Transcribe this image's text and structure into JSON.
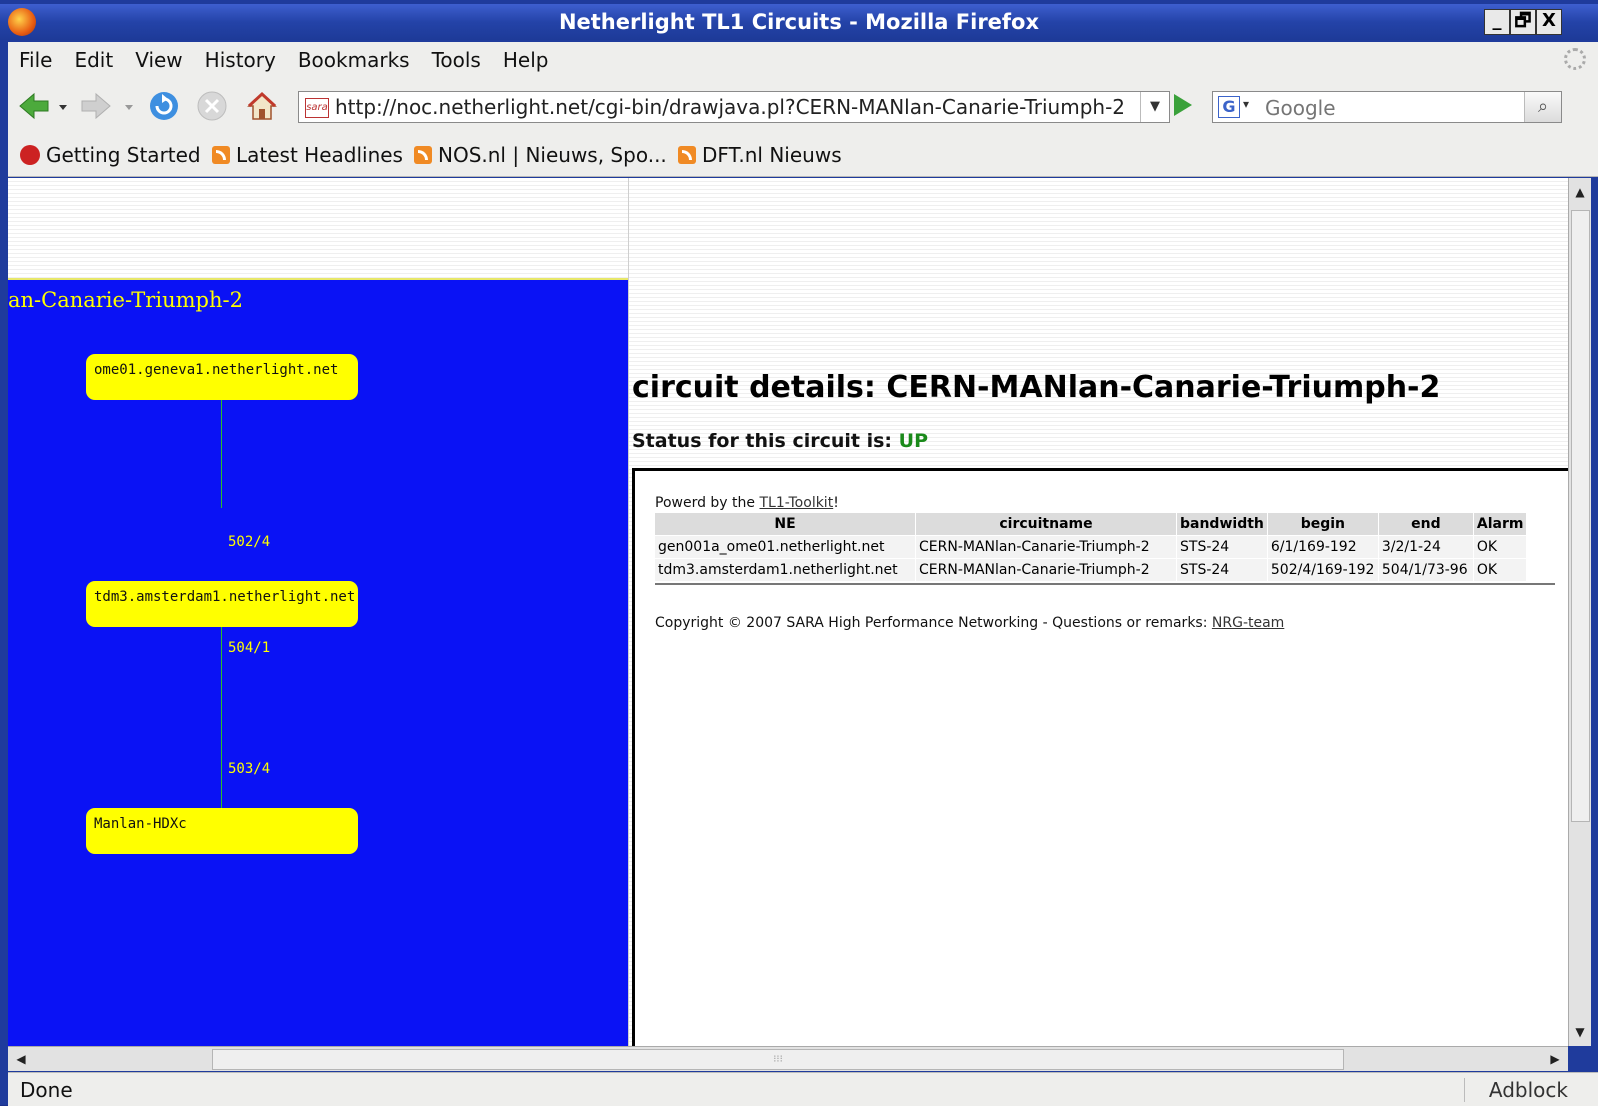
{
  "window": {
    "title": "Netherlight TL1 Circuits - Mozilla Firefox",
    "controls": [
      "_",
      "🗗",
      "X"
    ]
  },
  "menu": [
    "File",
    "Edit",
    "View",
    "History",
    "Bookmarks",
    "Tools",
    "Help"
  ],
  "navbar": {
    "url": "http://noc.netherlight.net/cgi-bin/drawjava.pl?CERN-MANlan-Canarie-Triumph-2",
    "site_icon_text": "sara",
    "search_placeholder": "Google",
    "search_engine_letter": "G"
  },
  "bookmarks": [
    {
      "label": "Getting Started",
      "icon": "firefox-icon"
    },
    {
      "label": "Latest Headlines",
      "icon": "rss-icon"
    },
    {
      "label": "NOS.nl | Nieuws, Spo...",
      "icon": "rss-icon"
    },
    {
      "label": "DFT.nl Nieuws",
      "icon": "rss-icon"
    }
  ],
  "applet": {
    "title": "an-Canarie-Triumph-2",
    "nodes": [
      "ome01.geneva1.netherlight.net",
      "tdm3.amsterdam1.netherlight.net",
      "Manlan-HDXc"
    ],
    "ports": [
      "502/4",
      "504/1",
      "503/4"
    ]
  },
  "details": {
    "heading": "circuit details: CERN-MANlan-Canarie-Triumph-2",
    "status_label": "Status for this circuit is:",
    "status_value": "UP",
    "powered_prefix": "Powerd by the",
    "powered_link": "TL1-Toolkit",
    "powered_suffix": "!",
    "table": {
      "headers": [
        "NE",
        "circuitname",
        "bandwidth",
        "begin",
        "end",
        "Alarm"
      ],
      "rows": [
        [
          "gen001a_ome01.netherlight.net",
          "CERN-MANlan-Canarie-Triumph-2",
          "STS-24",
          "6/1/169-192",
          "3/2/1-24",
          "OK"
        ],
        [
          "tdm3.amsterdam1.netherlight.net",
          "CERN-MANlan-Canarie-Triumph-2",
          "STS-24",
          "502/4/169-192",
          "504/1/73-96",
          "OK"
        ]
      ]
    },
    "copyright_text": "Copyright © 2007 SARA High Performance Networking - Questions or remarks:",
    "copyright_link": "NRG-team"
  },
  "statusbar": {
    "status": "Done",
    "addon": "Adblock"
  },
  "colors": {
    "applet_bg": "#0a12f5",
    "node_fill": "#ffff00",
    "edge": "#2bbd2b",
    "status_up": "#1a8a1a"
  }
}
